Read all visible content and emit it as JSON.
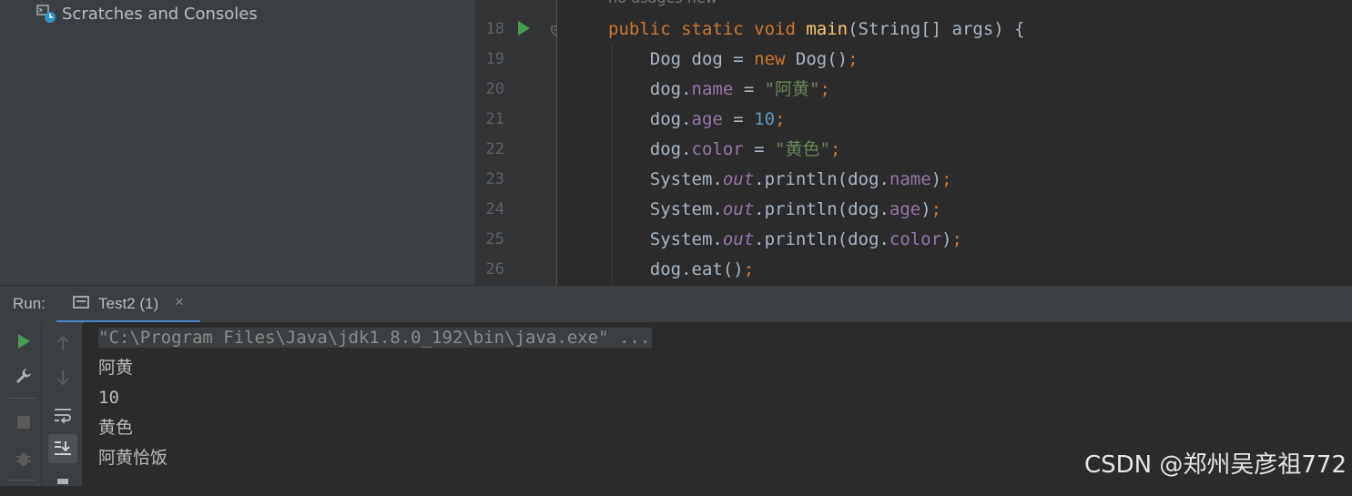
{
  "project": {
    "scratches_label": "Scratches and Consoles"
  },
  "editor": {
    "usage_hint": "no usages  new *",
    "lines": [
      {
        "num": "18"
      },
      {
        "num": "19"
      },
      {
        "num": "20"
      },
      {
        "num": "21"
      },
      {
        "num": "22"
      },
      {
        "num": "23"
      },
      {
        "num": "24"
      },
      {
        "num": "25"
      },
      {
        "num": "26"
      }
    ]
  },
  "run": {
    "label": "Run:",
    "tab_title": "Test2 (1)",
    "tab_close": "×"
  },
  "console": {
    "command": "\"C:\\Program Files\\Java\\jdk1.8.0_192\\bin\\java.exe\" ...",
    "output": [
      "阿黄",
      "10",
      "黄色",
      "阿黄恰饭"
    ]
  },
  "watermark": "CSDN @郑州吴彦祖772"
}
